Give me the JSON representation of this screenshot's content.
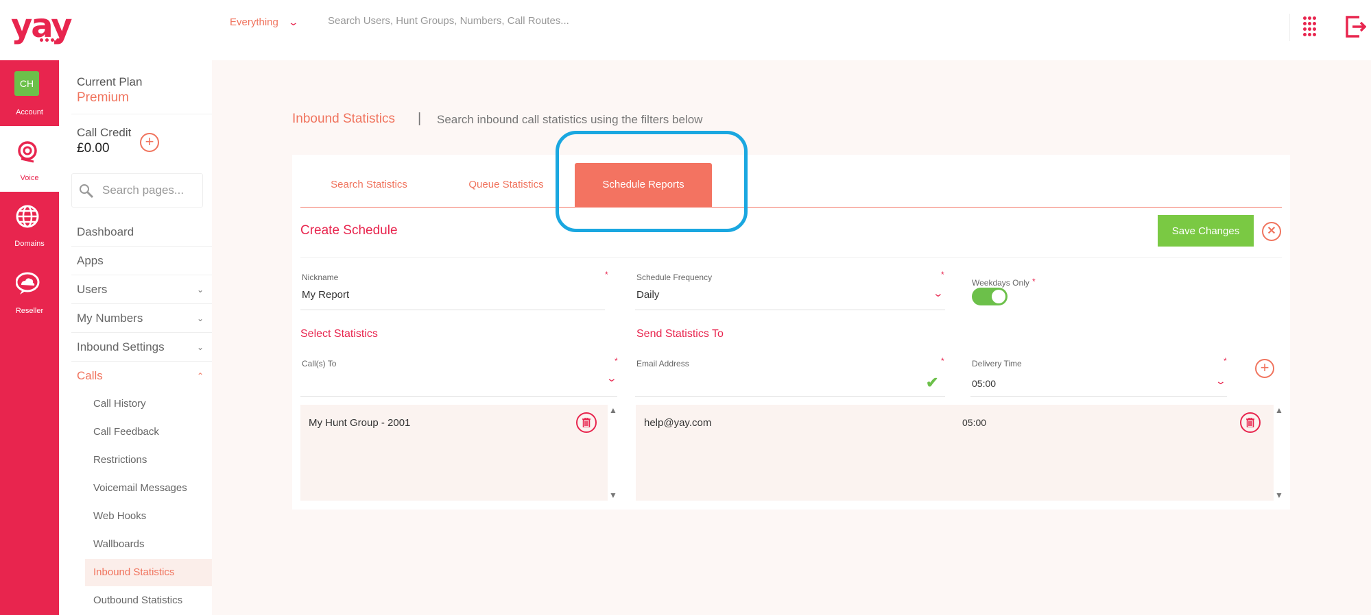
{
  "app": {
    "logo_text": "yay"
  },
  "topbar": {
    "scope_label": "Everything",
    "search_placeholder": "Search Users, Hunt Groups, Numbers, Call Routes..."
  },
  "rail": {
    "account_initials": "CH",
    "items": [
      {
        "label": "Account",
        "icon": "avatar-icon"
      },
      {
        "label": "Voice",
        "icon": "headset-icon"
      },
      {
        "label": "Domains",
        "icon": "globe-icon"
      },
      {
        "label": "Reseller",
        "icon": "cloud-icon"
      }
    ]
  },
  "nav": {
    "plan_label": "Current Plan",
    "plan_value": "Premium",
    "credit_label": "Call Credit",
    "credit_value": "£0.00",
    "search_placeholder": "Search pages...",
    "items": [
      {
        "label": "Dashboard"
      },
      {
        "label": "Apps"
      },
      {
        "label": "Users"
      },
      {
        "label": "My Numbers"
      },
      {
        "label": "Inbound Settings"
      },
      {
        "label": "Calls"
      }
    ],
    "sub_items": [
      "Call History",
      "Call Feedback",
      "Restrictions",
      "Voicemail Messages",
      "Web Hooks",
      "Wallboards",
      "Inbound Statistics",
      "Outbound Statistics"
    ]
  },
  "page": {
    "title": "Inbound Statistics",
    "pipe": "|",
    "subtitle": "Search inbound call statistics using the filters below"
  },
  "tabs": [
    "Search Statistics",
    "Queue Statistics",
    "Schedule Reports"
  ],
  "form": {
    "section_title": "Create Schedule",
    "save_label": "Save Changes",
    "nickname_label": "Nickname",
    "nickname_value": "My Report",
    "frequency_label": "Schedule Frequency",
    "frequency_value": "Daily",
    "weekdays_label": "Weekdays Only",
    "weekdays_on": true,
    "required_mark": "*",
    "select_title": "Select Statistics",
    "send_title": "Send Statistics To",
    "calls_to_label": "Call(s) To",
    "email_label": "Email Address",
    "delivery_label": "Delivery Time",
    "delivery_value": "05:00"
  },
  "stats_list": [
    {
      "name": "My Hunt Group - 2001"
    }
  ],
  "recipients_list": [
    {
      "email": "help@yay.com",
      "time": "05:00"
    }
  ],
  "colors": {
    "brand": "#e8254e",
    "accent": "#f37361",
    "success": "#7ac943",
    "highlight": "#1aa7e0"
  }
}
